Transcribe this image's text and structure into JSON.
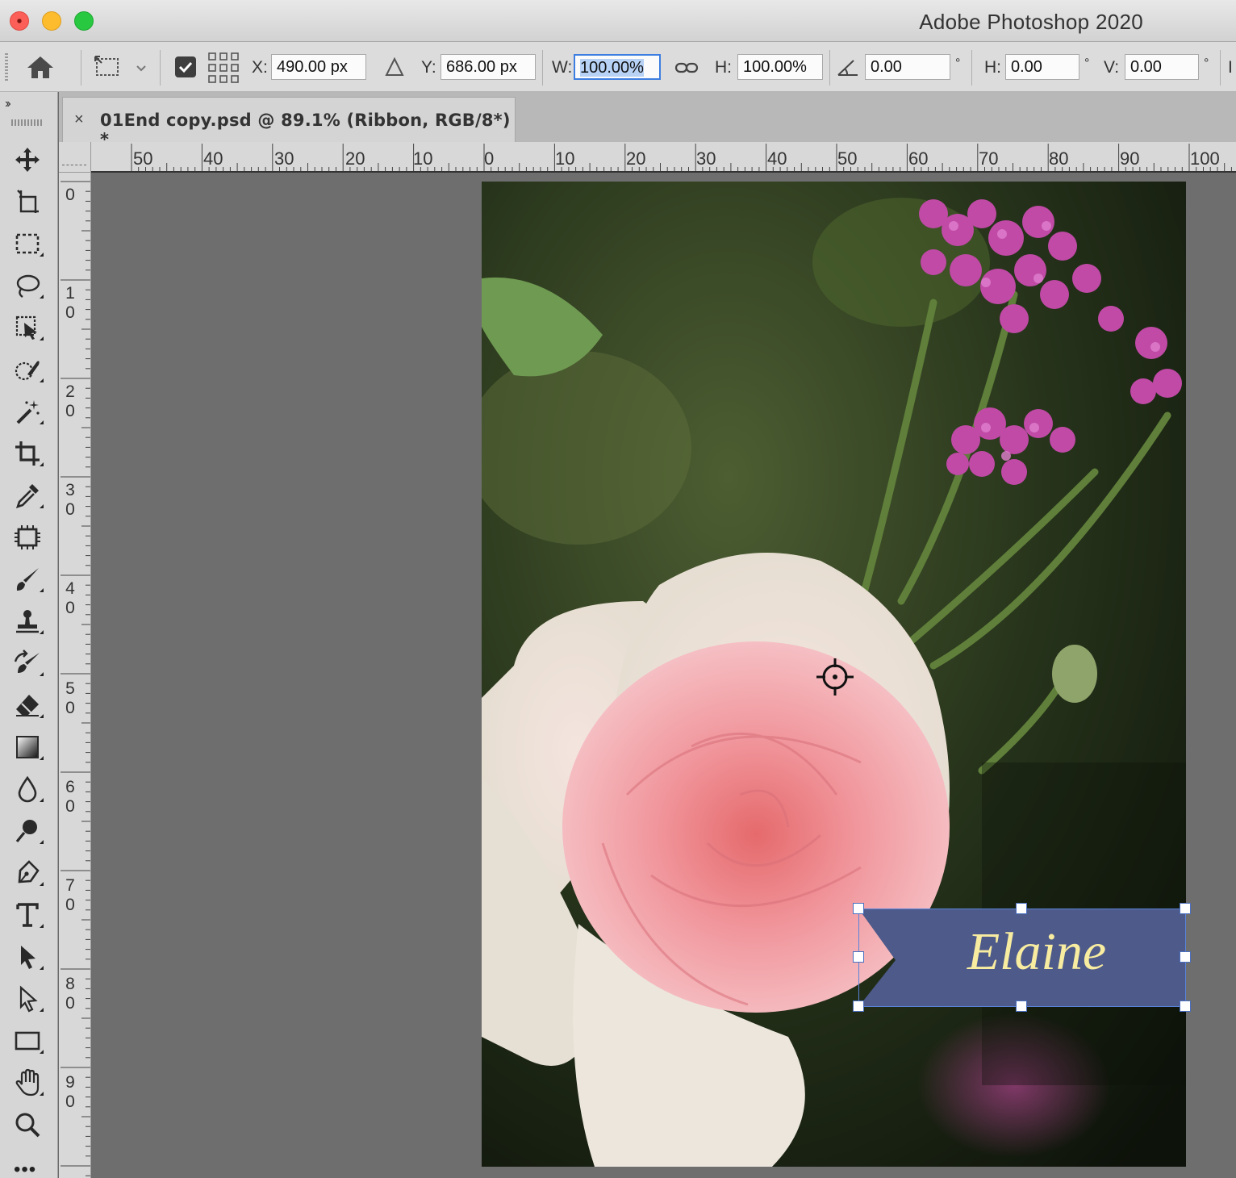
{
  "window": {
    "title": "Adobe Photoshop 2020"
  },
  "options_bar": {
    "x_label": "X:",
    "x_value": "490.00 px",
    "y_label": "Y:",
    "y_value": "686.00 px",
    "w_label": "W:",
    "w_value": "100.00%",
    "h_label": "H:",
    "h_value": "100.00%",
    "angle_value": "0.00",
    "degree_symbol": "°",
    "skew_h_label": "H:",
    "skew_h_value": "0.00",
    "skew_v_label": "V:",
    "skew_v_value": "0.00",
    "overflow_label": "I"
  },
  "toolbar": {
    "expand_label": "››",
    "more_label": "•••",
    "tools": [
      "move-tool",
      "artboard-tool",
      "rectangular-marquee-tool",
      "lasso-tool",
      "object-selection-tool",
      "quick-selection-tool",
      "magic-wand-tool",
      "crop-tool",
      "eyedropper-tool",
      "frame-tool",
      "brush-tool",
      "clone-stamp-tool",
      "history-brush-tool",
      "eraser-tool",
      "gradient-tool",
      "blur-tool",
      "dodge-tool",
      "pen-tool",
      "type-tool",
      "path-selection-tool",
      "direct-selection-tool",
      "rectangle-tool",
      "hand-tool",
      "zoom-tool"
    ]
  },
  "document": {
    "tab_close": "×",
    "tab_title": "01End copy.psd @ 89.1% (Ribbon, RGB/8*) *"
  },
  "rulers": {
    "horizontal": [
      "50",
      "40",
      "30",
      "20",
      "10",
      "0",
      "10",
      "20",
      "30",
      "40",
      "50",
      "60",
      "70",
      "80",
      "90",
      "100"
    ],
    "vertical": [
      {
        "d1": "0",
        "d2": ""
      },
      {
        "d1": "1",
        "d2": "0"
      },
      {
        "d1": "2",
        "d2": "0"
      },
      {
        "d1": "3",
        "d2": "0"
      },
      {
        "d1": "4",
        "d2": "0"
      },
      {
        "d1": "5",
        "d2": "0"
      },
      {
        "d1": "6",
        "d2": "0"
      },
      {
        "d1": "7",
        "d2": "0"
      },
      {
        "d1": "8",
        "d2": "0"
      },
      {
        "d1": "9",
        "d2": "0"
      }
    ]
  },
  "canvas": {
    "ribbon_text": "Elaine",
    "ribbon_color": "#4d5a8a",
    "ribbon_text_color": "#f8eca0"
  }
}
